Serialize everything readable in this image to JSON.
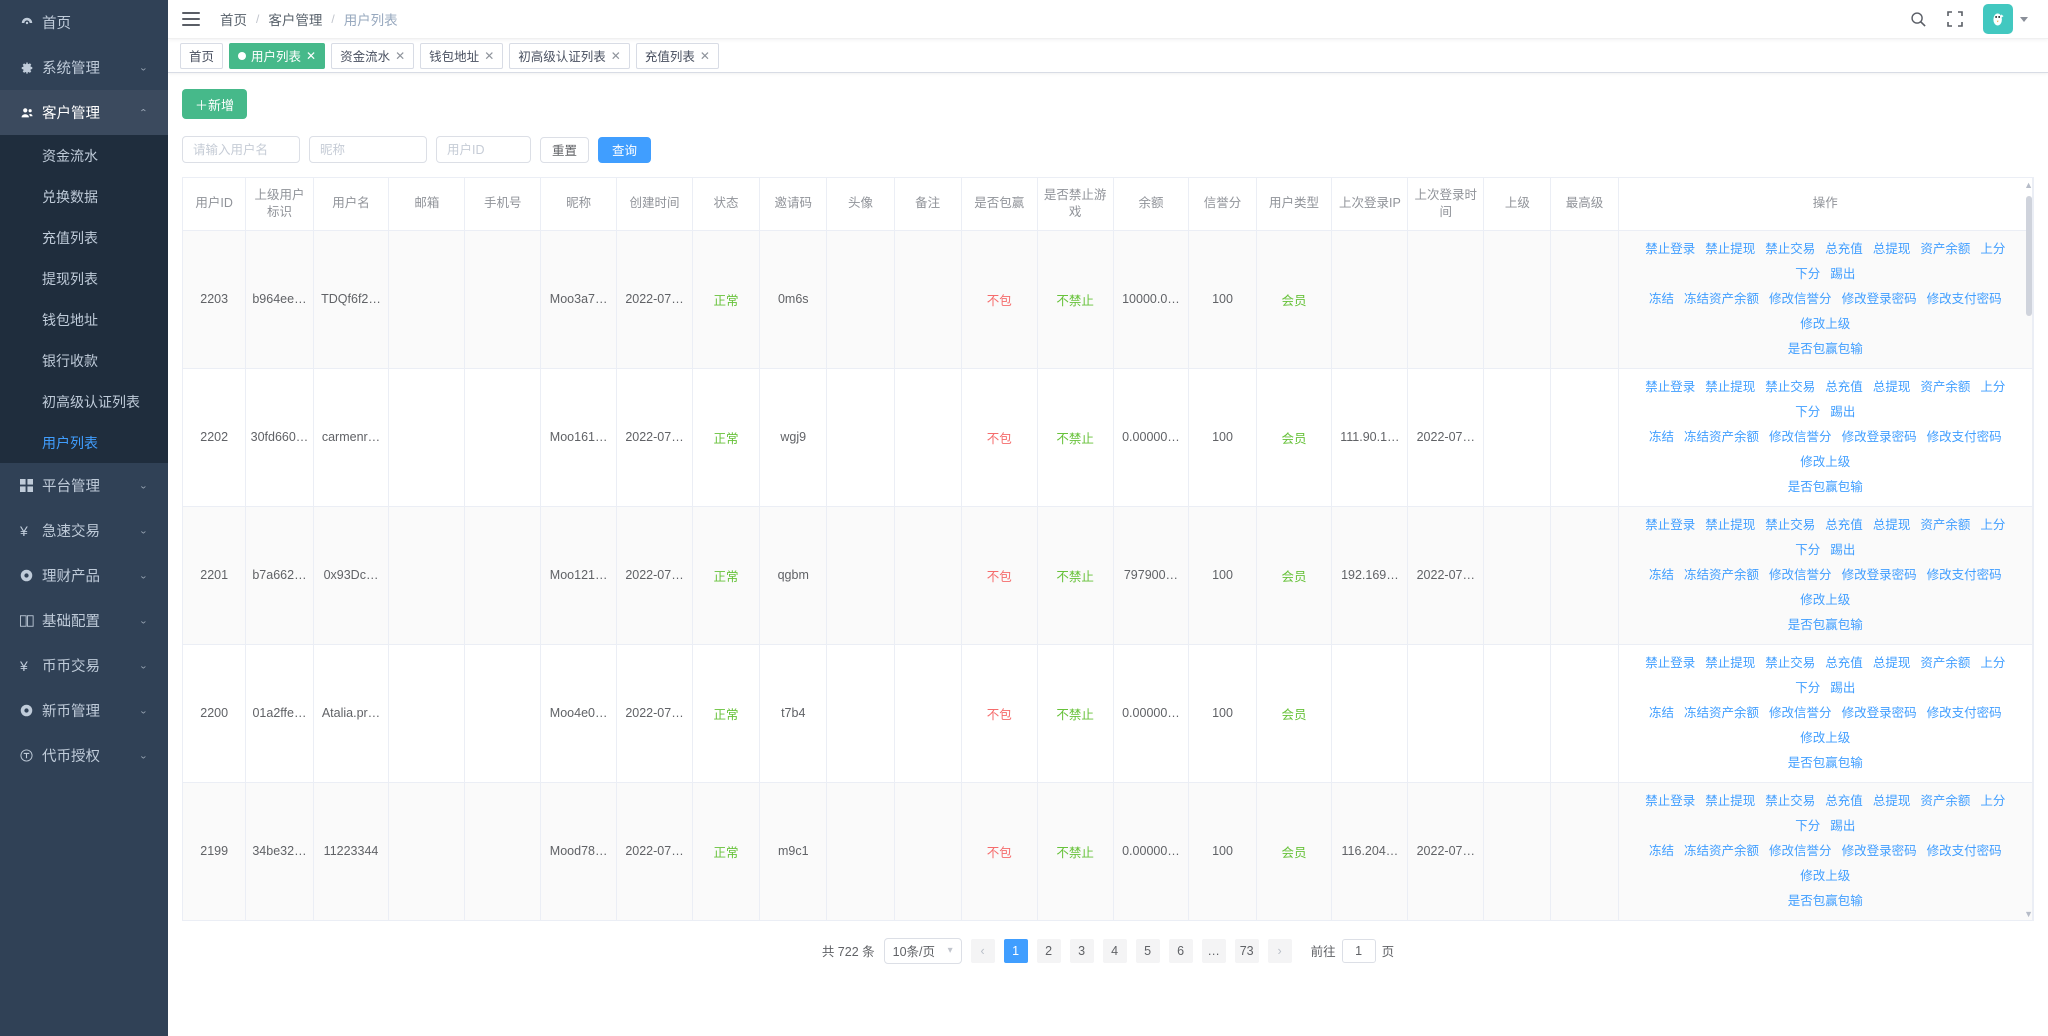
{
  "sidebar": {
    "items": [
      {
        "label": "首页",
        "icon": "dashboard-icon",
        "glyph": "⊛",
        "expandable": false
      },
      {
        "label": "系统管理",
        "icon": "gear-icon",
        "glyph": "✿",
        "expandable": true
      },
      {
        "label": "客户管理",
        "icon": "users-icon",
        "glyph": "👥",
        "expandable": true,
        "expanded": true
      }
    ],
    "customer_submenu": [
      {
        "label": "资金流水"
      },
      {
        "label": "兑换数据"
      },
      {
        "label": "充值列表"
      },
      {
        "label": "提现列表"
      },
      {
        "label": "钱包地址"
      },
      {
        "label": "银行收款"
      },
      {
        "label": "初高级认证列表"
      },
      {
        "label": "用户列表",
        "selected": true
      }
    ],
    "items_after": [
      {
        "label": "平台管理",
        "icon": "grid-icon",
        "glyph": "▦",
        "expandable": true
      },
      {
        "label": "急速交易",
        "icon": "yen-icon",
        "glyph": "¥",
        "expandable": true
      },
      {
        "label": "理财产品",
        "icon": "coin-icon",
        "glyph": "◈",
        "expandable": true
      },
      {
        "label": "基础配置",
        "icon": "book-icon",
        "glyph": "▯▯",
        "expandable": true
      },
      {
        "label": "币币交易",
        "icon": "yen-icon",
        "glyph": "¥",
        "expandable": true
      },
      {
        "label": "新币管理",
        "icon": "coin-icon",
        "glyph": "◈",
        "expandable": true
      },
      {
        "label": "代币授权",
        "icon": "token-icon",
        "glyph": "Ⓣ",
        "expandable": true
      }
    ]
  },
  "navbar": {
    "breadcrumb": [
      "首页",
      "客户管理",
      "用户列表"
    ],
    "search_icon": "search-icon",
    "fullscreen_icon": "fullscreen-icon",
    "avatar_glyph": "🐧"
  },
  "tags": [
    {
      "label": "首页",
      "active": false,
      "closable": false
    },
    {
      "label": "用户列表",
      "active": true,
      "closable": true
    },
    {
      "label": "资金流水",
      "active": false,
      "closable": true
    },
    {
      "label": "钱包地址",
      "active": false,
      "closable": true
    },
    {
      "label": "初高级认证列表",
      "active": false,
      "closable": true
    },
    {
      "label": "充值列表",
      "active": false,
      "closable": true
    }
  ],
  "toolbar": {
    "add_label": "＋新增",
    "username_placeholder": "请输入用户名",
    "nickname_placeholder": "昵称",
    "userid_placeholder": "用户ID",
    "username_value": "",
    "nickname_value": "",
    "userid_value": "",
    "reset_label": "重置",
    "query_label": "查询"
  },
  "table": {
    "columns": [
      "用户ID",
      "上级用户标识",
      "用户名",
      "邮箱",
      "手机号",
      "昵称",
      "创建时间",
      "状态",
      "邀请码",
      "头像",
      "备注",
      "是否包赢",
      "是否禁止游戏",
      "余额",
      "信誉分",
      "用户类型",
      "上次登录IP",
      "上次登录时间",
      "上级",
      "最高级",
      "操作"
    ],
    "op_links_row1": [
      "禁止登录",
      "禁止提现",
      "禁止交易",
      "总充值",
      "总提现",
      "资产余额",
      "上分",
      "下分",
      "踢出"
    ],
    "op_links_row2": [
      "冻结",
      "冻结资产余额",
      "修改信誉分",
      "修改登录密码",
      "修改支付密码",
      "修改上级"
    ],
    "op_links_row3": [
      "是否包赢包输"
    ],
    "rows": [
      {
        "id": "2203",
        "parent": "b964ee…",
        "username": "TDQf6f2…",
        "email": "",
        "phone": "",
        "nickname": "Moo3a7…",
        "created": "2022-07…",
        "status": "正常",
        "invite": "0m6s",
        "avatar": "",
        "remark": "",
        "baoying": "不包",
        "banned": "不禁止",
        "balance": "10000.0…",
        "credit": "100",
        "usertype": "会员",
        "last_ip": "",
        "last_time": "",
        "superior": "",
        "top": ""
      },
      {
        "id": "2202",
        "parent": "30fd660…",
        "username": "carmenr…",
        "email": "",
        "phone": "",
        "nickname": "Moo161…",
        "created": "2022-07…",
        "status": "正常",
        "invite": "wgj9",
        "avatar": "",
        "remark": "",
        "baoying": "不包",
        "banned": "不禁止",
        "balance": "0.00000…",
        "credit": "100",
        "usertype": "会员",
        "last_ip": "111.90.1…",
        "last_time": "2022-07…",
        "superior": "",
        "top": ""
      },
      {
        "id": "2201",
        "parent": "b7a662…",
        "username": "0x93Dc…",
        "email": "",
        "phone": "",
        "nickname": "Moo121…",
        "created": "2022-07…",
        "status": "正常",
        "invite": "qgbm",
        "avatar": "",
        "remark": "",
        "baoying": "不包",
        "banned": "不禁止",
        "balance": "797900…",
        "credit": "100",
        "usertype": "会员",
        "last_ip": "192.169…",
        "last_time": "2022-07…",
        "superior": "",
        "top": ""
      },
      {
        "id": "2200",
        "parent": "01a2ffe…",
        "username": "Atalia.pr…",
        "email": "",
        "phone": "",
        "nickname": "Moo4e0…",
        "created": "2022-07…",
        "status": "正常",
        "invite": "t7b4",
        "avatar": "",
        "remark": "",
        "baoying": "不包",
        "banned": "不禁止",
        "balance": "0.00000…",
        "credit": "100",
        "usertype": "会员",
        "last_ip": "",
        "last_time": "",
        "superior": "",
        "top": ""
      },
      {
        "id": "2199",
        "parent": "34be32…",
        "username": "11223344",
        "email": "",
        "phone": "",
        "nickname": "Mood78…",
        "created": "2022-07…",
        "status": "正常",
        "invite": "m9c1",
        "avatar": "",
        "remark": "",
        "baoying": "不包",
        "banned": "不禁止",
        "balance": "0.00000…",
        "credit": "100",
        "usertype": "会员",
        "last_ip": "116.204…",
        "last_time": "2022-07…",
        "superior": "",
        "top": ""
      }
    ]
  },
  "pagination": {
    "total_label": "共 722 条",
    "page_size_label": "10条/页",
    "pages": [
      "1",
      "2",
      "3",
      "4",
      "5",
      "6",
      "…",
      "73"
    ],
    "current": "1",
    "prev_glyph": "‹",
    "next_glyph": "›",
    "jump_prefix": "前往",
    "jump_value": "1",
    "jump_suffix": "页"
  },
  "colors": {
    "sidebar_bg": "#304156",
    "submenu_bg": "#1f2d3d",
    "accent_green": "#46b98a",
    "accent_blue": "#409EFF",
    "status_green": "#67C23A",
    "status_red": "#F56C6C",
    "avatar_bg": "#42c8c0"
  }
}
